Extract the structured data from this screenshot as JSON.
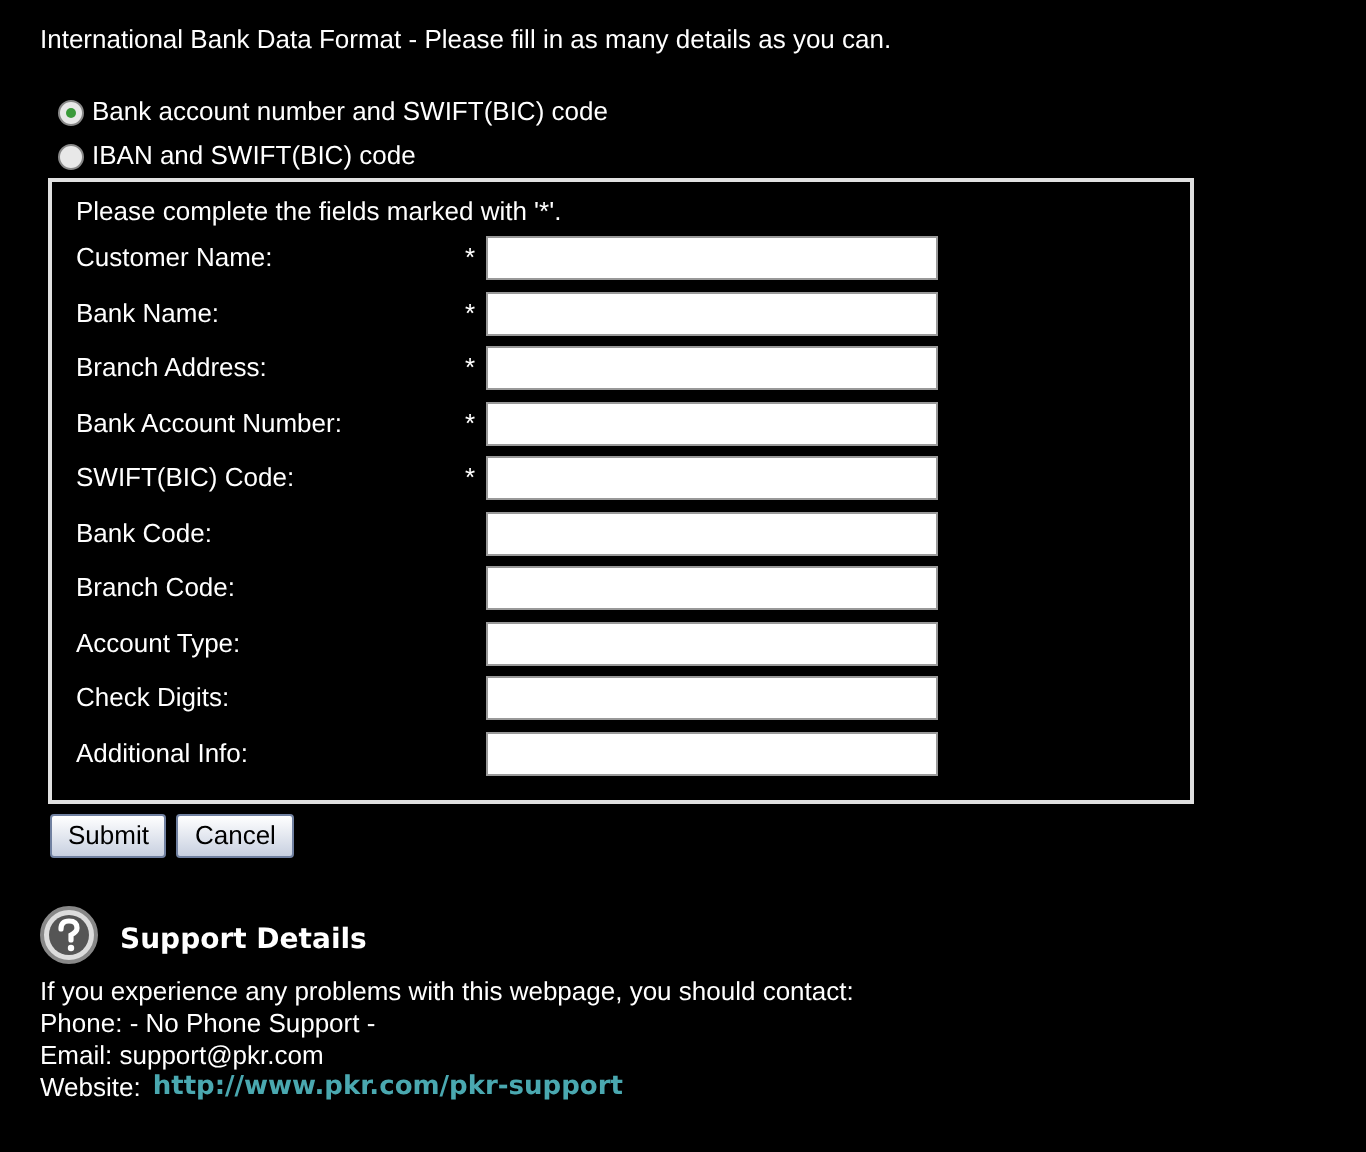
{
  "heading": "International Bank Data Format - Please fill in as many details as you can.",
  "formats": [
    {
      "label": "Bank account number and SWIFT(BIC) code",
      "selected": true
    },
    {
      "label": "IBAN and SWIFT(BIC) code",
      "selected": false
    }
  ],
  "form": {
    "instruction": "Please complete the fields marked with '*'.",
    "required_mark": "*",
    "fields": [
      {
        "label": "Customer Name:",
        "required": true
      },
      {
        "label": "Bank Name:",
        "required": true
      },
      {
        "label": "Branch Address:",
        "required": true
      },
      {
        "label": "Bank Account Number:",
        "required": true
      },
      {
        "label": "SWIFT(BIC) Code:",
        "required": true
      },
      {
        "label": "Bank Code:",
        "required": false
      },
      {
        "label": "Branch Code:",
        "required": false
      },
      {
        "label": "Account Type:",
        "required": false
      },
      {
        "label": "Check Digits:",
        "required": false
      },
      {
        "label": "Additional Info:",
        "required": false
      }
    ]
  },
  "buttons": [
    "Submit",
    "Cancel"
  ],
  "support": {
    "title": "Support Details",
    "intro": "If you experience any problems with this webpage, you should contact:",
    "phone": "Phone: - No Phone Support -",
    "email": "Email: support@pkr.com",
    "website_label": "Website:",
    "website_link": "http://www.pkr.com/pkr-support"
  }
}
